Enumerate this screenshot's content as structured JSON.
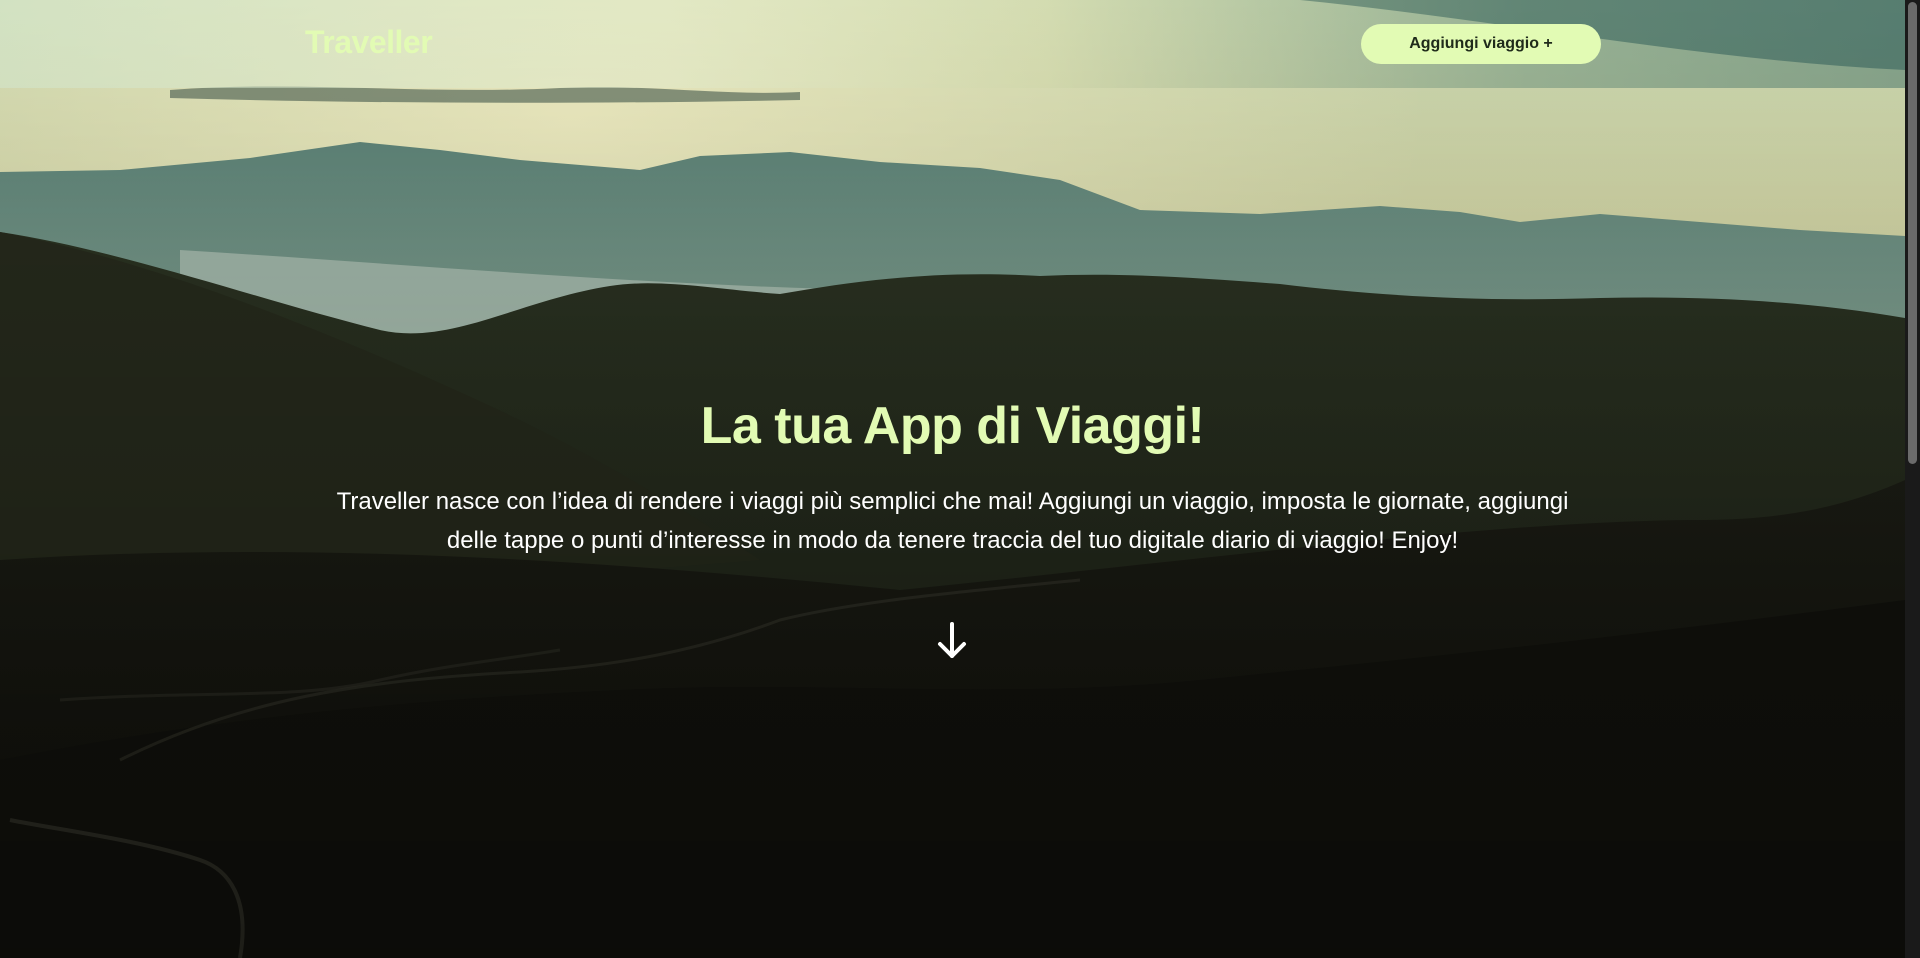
{
  "header": {
    "brand": "Traveller",
    "add_trip_label": "Aggiungi viaggio +"
  },
  "hero": {
    "title": "La tua App di Viaggi!",
    "description": "Traveller nasce con l’idea di rendere i viaggi più semplici che mai! Aggiungi un viaggio, imposta le giornate, aggiungi delle tappe o punti d’interesse in modo da tenere traccia del tuo digitale diario di viaggio! Enjoy!",
    "scroll_icon": "arrow-down-icon"
  },
  "colors": {
    "accent": "#e2fbb4",
    "button_text": "#1f2a1a",
    "body_text": "#ffffff"
  }
}
